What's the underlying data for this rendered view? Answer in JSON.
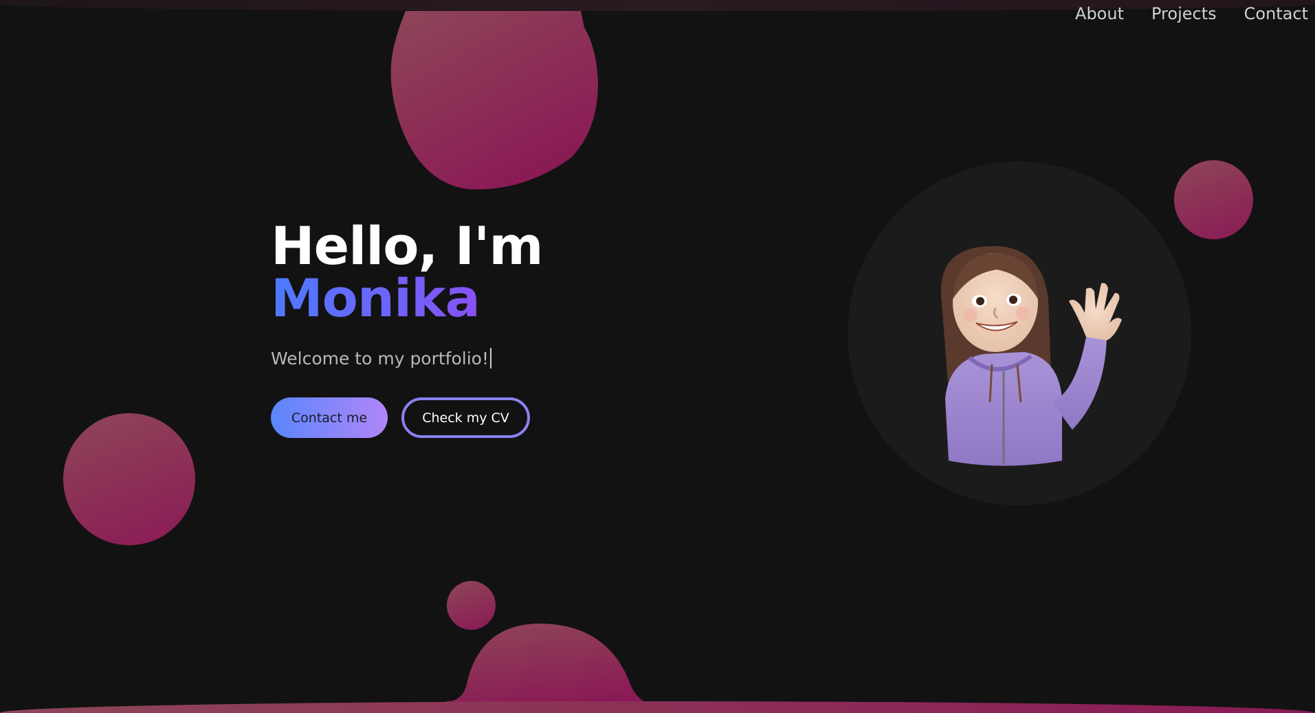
{
  "nav": {
    "items": [
      {
        "label": "About"
      },
      {
        "label": "Projects"
      },
      {
        "label": "Contact"
      }
    ]
  },
  "hero": {
    "greeting": "Hello, I'm",
    "name": "Monika",
    "subtitle": "Welcome to my portfolio!",
    "buttons": {
      "contact_label": "Contact me",
      "cv_label": "Check my CV"
    }
  },
  "colors": {
    "background": "#121212",
    "blob": "#8a1a55",
    "accent_blue": "#4c7bff",
    "accent_purple": "#9b45f2"
  },
  "avatar": {
    "icon": "waving-memoji-avatar"
  }
}
